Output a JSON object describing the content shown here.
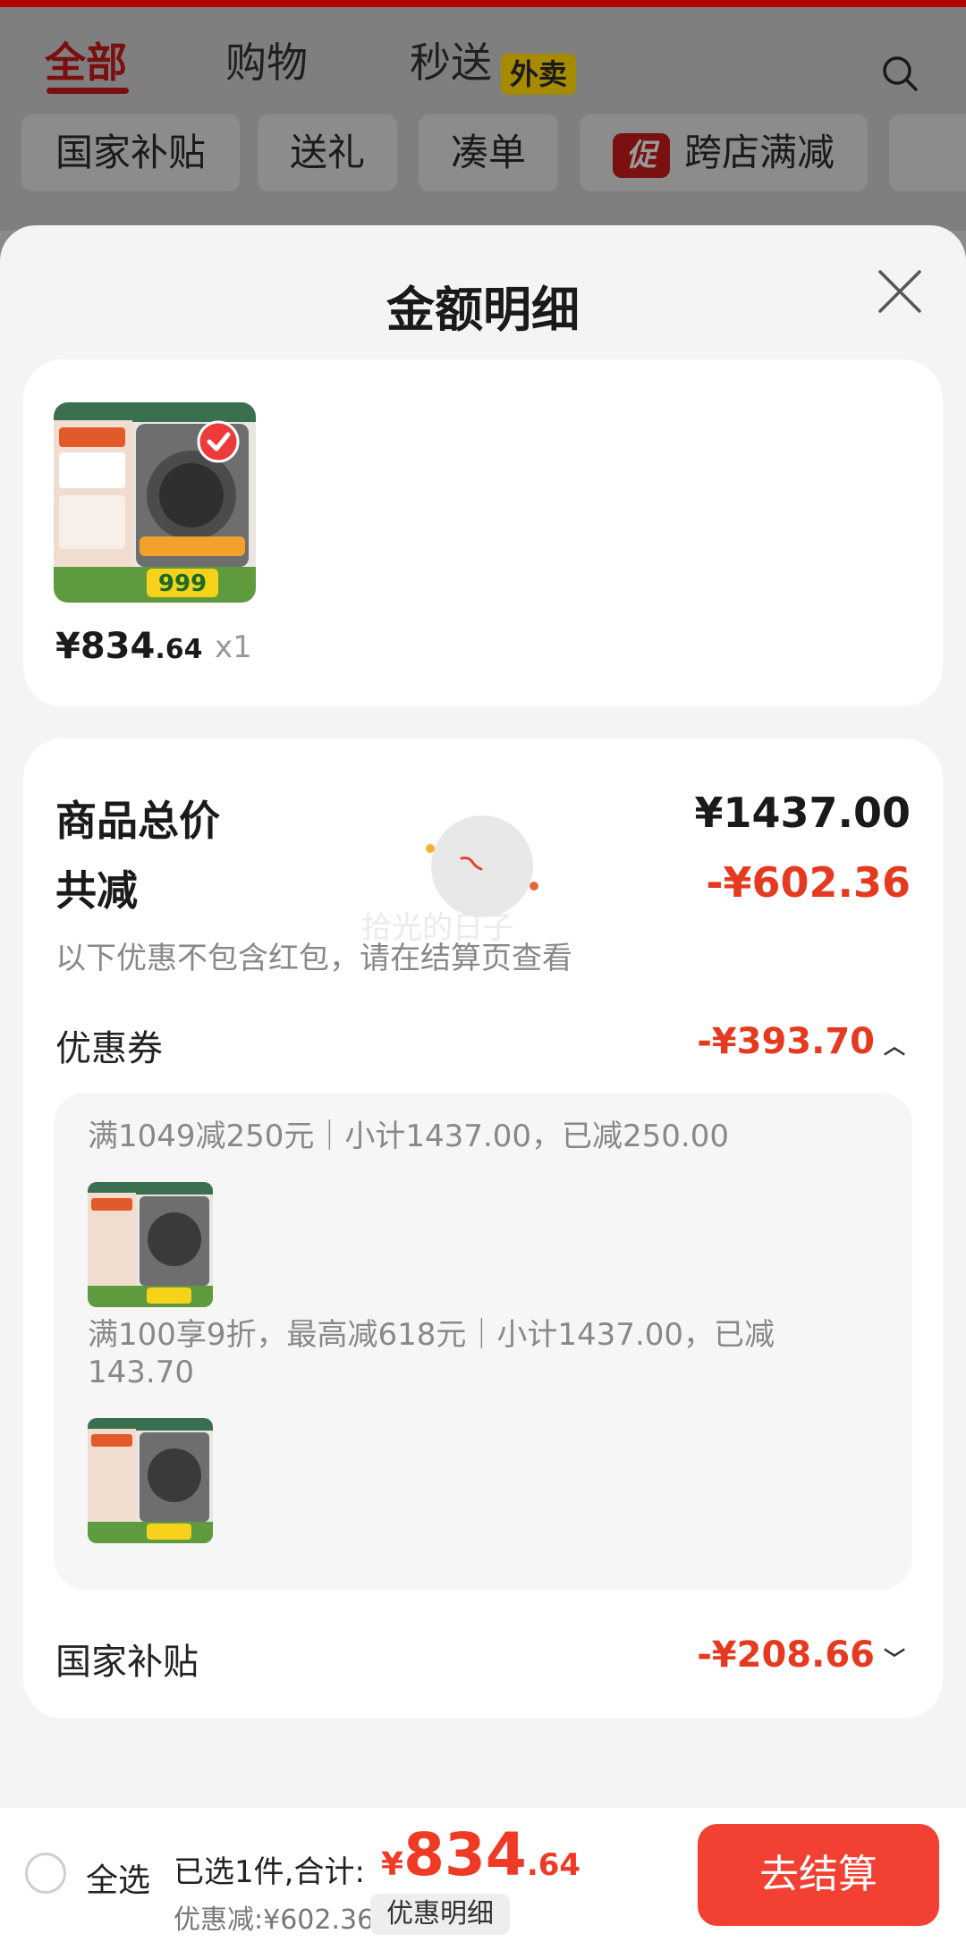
{
  "top_tabs": [
    {
      "label": "全部"
    },
    {
      "label": "购物"
    },
    {
      "label": "秒送"
    }
  ],
  "top_tabs_badge": "外卖",
  "filter_chips": [
    {
      "label": "国家补贴"
    },
    {
      "label": "送礼"
    },
    {
      "label": "凑单"
    },
    {
      "label": "跨店满减",
      "promo_tag": "促"
    }
  ],
  "sheet": {
    "title": "金额明细",
    "product": {
      "price_int": "¥834",
      "price_dec": ".64",
      "qty": "x1"
    },
    "summary": {
      "total_label": "商品总价",
      "total_value": "¥1437.00",
      "reduce_label": "共减",
      "reduce_value": "-¥602.36",
      "reduce_note": "以下优惠不包含红包，请在结算页查看",
      "coupon_label": "优惠券",
      "coupon_value": "-¥393.70",
      "coupon_details": [
        {
          "text": "满1049减250元｜小计1437.00，已减250.00"
        },
        {
          "text": "满100享9折，最高减618元｜小计1437.00，已减143.70"
        }
      ],
      "subsidy_label": "国家补贴",
      "subsidy_value": "-¥208.66"
    },
    "watermark": "拾光的日子"
  },
  "bottom_bar": {
    "select_all": "全选",
    "selected_text": "已选1件,合计:",
    "total_currency": "¥",
    "total_int": "834",
    "total_dec": ".64",
    "discount_text": "优惠减:¥602.36",
    "detail_button": "优惠明细",
    "checkout_button": "去结算"
  },
  "colors": {
    "accent_red": "#e53a1f",
    "checkout_red": "#f24132",
    "sheet_bg": "#f4f4f4"
  }
}
